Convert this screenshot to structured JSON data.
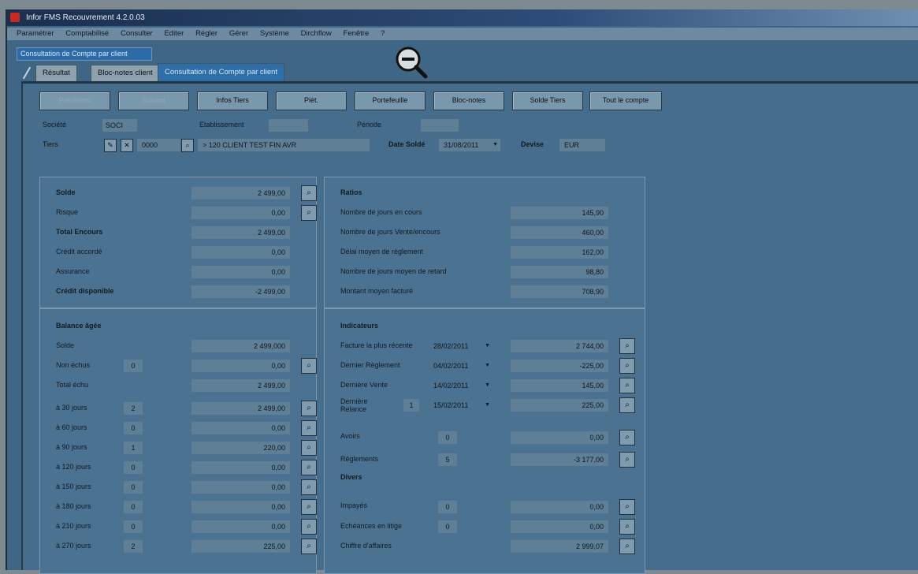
{
  "app": {
    "title": "Infor FMS Recouvrement 4.2.0.03"
  },
  "menu": [
    "Paramétrer",
    "Comptabilisé",
    "Consulter",
    "Editer",
    "Régler",
    "Gérer",
    "Système",
    "Dirchflow",
    "Fenêtre",
    "?"
  ],
  "doc_strip": "Consultation de Compte par client",
  "tabs": [
    {
      "label": "Résultat"
    },
    {
      "label": "Bloc-notes client"
    },
    {
      "label": "Consultation de Compte par client"
    }
  ],
  "toolbar": [
    "Précédent",
    "Suivant",
    "Infos Tiers",
    "Pièt.",
    "Portefeuille",
    "Bloc-notes",
    "Solde Tiers",
    "Tout le compte"
  ],
  "header": {
    "societe_label": "Société",
    "societe_value": "SOCI",
    "etab_label": "Etablissement",
    "etab_value": "",
    "periode_label": "Période",
    "periode_value": "",
    "tiers_label": "Tiers",
    "tiers_code": "0000",
    "tiers_name": "> 120 CLIENT TEST FIN AVR",
    "date_solde_label": "Date Soldé",
    "date_solde_value": "31/08/2011",
    "devise_label": "Devise",
    "devise_value": "EUR"
  },
  "solde_panel": {
    "rows": [
      {
        "label": "Solde",
        "value": "2 499,00",
        "bold": true
      },
      {
        "label": "Risque",
        "value": "0,00",
        "bold": false
      },
      {
        "label": "Total Encours",
        "value": "2 499,00",
        "bold": true
      },
      {
        "label": "Crédit accordé",
        "value": "0,00",
        "bold": false
      },
      {
        "label": "Assurance",
        "value": "0,00",
        "bold": false
      },
      {
        "label": "Crédit disponible",
        "value": "-2 499,00",
        "bold": true
      }
    ]
  },
  "ratios_panel": {
    "title": "Ratios",
    "rows": [
      {
        "label": "Nombre de jours en cours",
        "value": "145,90"
      },
      {
        "label": "Nombre de jours Vente/encours",
        "value": "460,00"
      },
      {
        "label": "Délai moyen de règlement",
        "value": "162,00"
      },
      {
        "label": "Nombre de jours moyen de retard",
        "value": "98,80"
      },
      {
        "label": "Montant moyen facturé",
        "value": "708,90"
      }
    ]
  },
  "balance_panel": {
    "title": "Balance âgée",
    "solde_label": "Solde",
    "solde_value": "2 499,000",
    "nonechus_label": "Non échus",
    "nonechus_count": "0",
    "nonechus_value": "0,00",
    "total_label": "Total échu",
    "total_value": "2 499,00",
    "rows": [
      {
        "label": "à 30 jours",
        "count": "2",
        "value": "2 499,00"
      },
      {
        "label": "à 60 jours",
        "count": "0",
        "value": "0,00"
      },
      {
        "label": "à 90 jours",
        "count": "1",
        "value": "220,00"
      },
      {
        "label": "à 120 jours",
        "count": "0",
        "value": "0,00"
      },
      {
        "label": "à 150 jours",
        "count": "0",
        "value": "0,00"
      },
      {
        "label": "à 180 jours",
        "count": "0",
        "value": "0,00"
      },
      {
        "label": "à 210 jours",
        "count": "0",
        "value": "0,00"
      },
      {
        "label": "à 270 jours",
        "count": "2",
        "value": "225,00"
      }
    ]
  },
  "indicateurs_panel": {
    "title": "Indicateurs",
    "rows": [
      {
        "label": "Facture la plus récente",
        "date": "28/02/2011",
        "count": "",
        "value": "2 744,00"
      },
      {
        "label": "Dernier Règlement",
        "date": "04/02/2011",
        "count": "",
        "value": "-225,00"
      },
      {
        "label": "Dernière Vente",
        "date": "14/02/2011",
        "count": "",
        "value": "145,00"
      },
      {
        "label": "Dernière Relance",
        "date": "15/02/2011",
        "count": "1",
        "value": "225,00"
      }
    ],
    "avoirs_label": "Avoirs",
    "avoirs_count": "0",
    "avoirs_value": "0,00",
    "reglements_label": "Règlements",
    "reglements_count": "5",
    "reglements_value": "-3 177,00",
    "divers_title": "Divers",
    "impayes_label": "Impayés",
    "impayes_count": "0",
    "impayes_value": "0,00",
    "effets_label": "Echéances en litige",
    "effets_count": "0",
    "effets_value": "0,00",
    "ca_label": "Chiffre d'affaires",
    "ca_value": "2 999,07"
  }
}
